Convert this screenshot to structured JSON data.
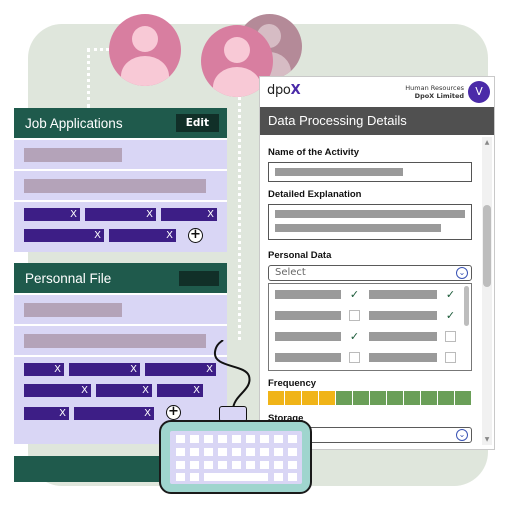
{
  "job_card": {
    "title": "Job Applications",
    "edit_label": "Edit",
    "chips": [
      "X",
      "X",
      "X",
      "X",
      "X"
    ],
    "add_symbol": "+"
  },
  "personnel_card": {
    "title": "Personnal File",
    "chips": [
      "X",
      "X",
      "X",
      "X",
      "X",
      "X",
      "X",
      "X",
      "X"
    ],
    "add_symbol": "+"
  },
  "panel": {
    "logo_text": "dpo",
    "logo_x": "X",
    "company_line1": "Human Resources",
    "company_line2": "DpoX Limited",
    "user_initial": "V",
    "title": "Data Processing Details",
    "name_label": "Name of the Activity",
    "explanation_label": "Detailed Explanation",
    "personal_data_label": "Personal Data",
    "select_placeholder": "Select",
    "select_icon": "chevron-down-circle-icon",
    "frequency_label": "Frequency",
    "storage_label": "Storage",
    "check_symbol": "✓",
    "options": [
      {
        "left_checked": true,
        "right_checked": true
      },
      {
        "left_checked": false,
        "right_checked": true
      },
      {
        "left_checked": true,
        "right_checked": false
      },
      {
        "left_checked": false,
        "right_checked": false
      }
    ],
    "frequency": {
      "total_segments": 12,
      "filled_segments": 4,
      "filled_color": "#f0b418",
      "empty_color": "#6a9f58"
    }
  },
  "colors": {
    "card_header": "#1f5a4c",
    "card_body": "#d9d6f5",
    "chip": "#3d1e86",
    "avatar_pink": "#d87ea0",
    "panel_header": "#505050",
    "accent": "#4a2aa8"
  }
}
